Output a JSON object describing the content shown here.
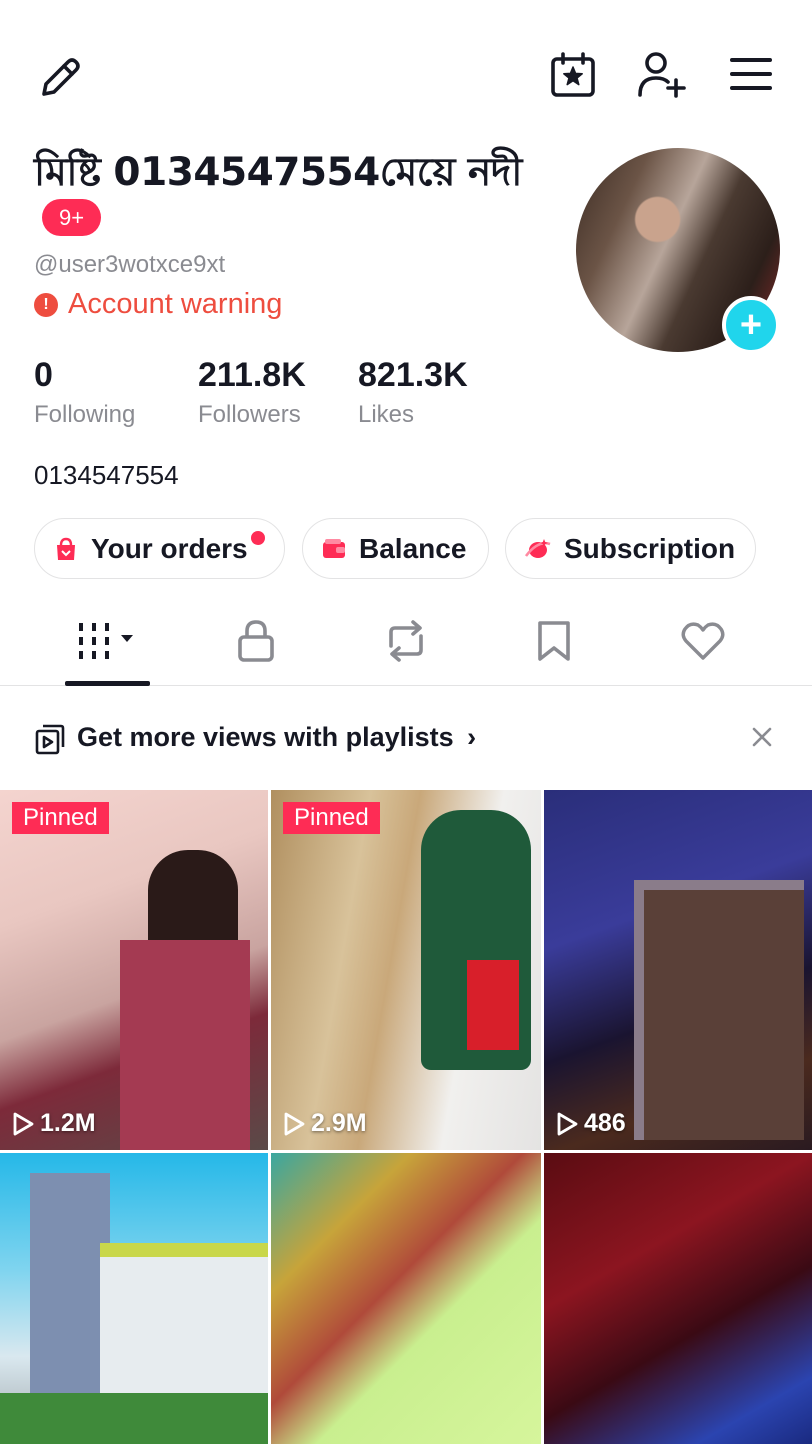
{
  "profile": {
    "display_name": "মিষ্টি 0134547554মেয়ে নদী",
    "badge": "9+",
    "handle": "@user3wotxce9xt",
    "warning": "Account warning",
    "bio": "0134547554"
  },
  "stats": [
    {
      "value": "0",
      "label": "Following"
    },
    {
      "value": "211.8K",
      "label": "Followers"
    },
    {
      "value": "821.3K",
      "label": "Likes"
    }
  ],
  "pills": [
    {
      "label": "Your orders",
      "icon": "shop-bag-icon"
    },
    {
      "label": "Balance",
      "icon": "wallet-icon"
    },
    {
      "label": "Subscription",
      "icon": "subscription-icon"
    }
  ],
  "tabs": [
    {
      "name": "videos",
      "icon": "grid-bars-icon",
      "active": true
    },
    {
      "name": "private",
      "icon": "lock-icon"
    },
    {
      "name": "reposts",
      "icon": "repost-icon"
    },
    {
      "name": "favorites",
      "icon": "bookmark-icon"
    },
    {
      "name": "liked",
      "icon": "heart-icon"
    }
  ],
  "promo": {
    "text": "Get more views with playlists",
    "chevron": "›"
  },
  "videos": [
    {
      "pinned_label": "Pinned",
      "views": "1.2M"
    },
    {
      "pinned_label": "Pinned",
      "views": "2.9M"
    },
    {
      "pinned_label": "",
      "views": "486"
    },
    {
      "pinned_label": "",
      "views": ""
    },
    {
      "pinned_label": "",
      "views": ""
    },
    {
      "pinned_label": "",
      "views": ""
    }
  ],
  "colors": {
    "accent": "#fe2c55",
    "warning": "#ee4d3f",
    "avatar_add": "#20d5ec",
    "muted_text": "#8a8b91"
  }
}
